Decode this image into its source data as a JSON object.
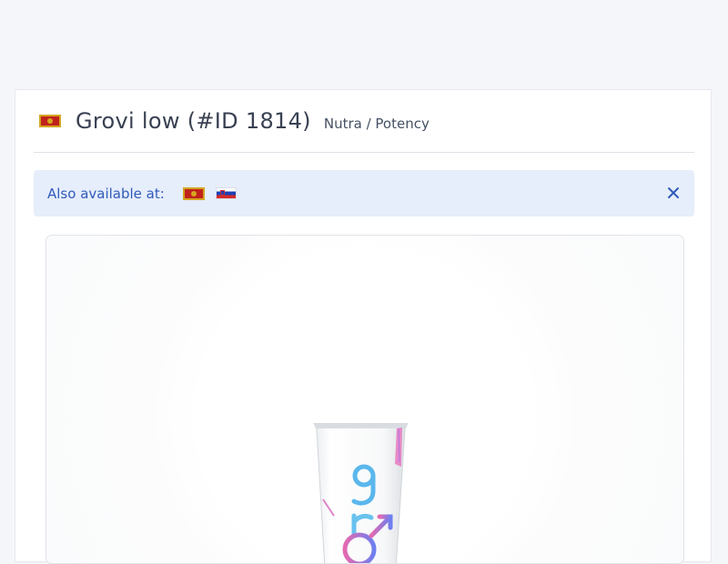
{
  "product": {
    "title": "Grovi low (#ID 1814)",
    "category": "Nutra / Potency",
    "country_flag": "montenegro-flag"
  },
  "availability": {
    "label": "Also available at:",
    "flags": [
      "montenegro-flag",
      "slovenia-flag"
    ],
    "close_icon": "close-icon"
  },
  "product_image": {
    "logo_text": "gr"
  },
  "colors": {
    "accent": "#2f5bb8",
    "alert_bg": "#e6edfb",
    "page_bg": "#f5f6f9",
    "title": "#394152"
  }
}
